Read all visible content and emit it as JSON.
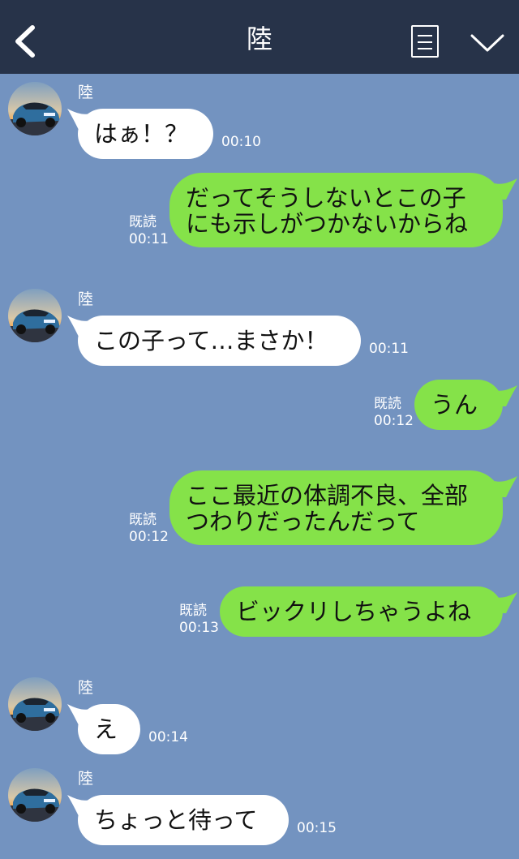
{
  "header": {
    "title": "陸"
  },
  "messages": [
    {
      "side": "in",
      "name": "陸",
      "text": "はぁ！？",
      "time": "00:10"
    },
    {
      "side": "out",
      "read": "既読",
      "lines": [
        "だってそうしないとこの子",
        "にも示しがつかないからね"
      ],
      "time": "00:11"
    },
    {
      "side": "in",
      "name": "陸",
      "text": "この子って…まさか！",
      "time": "00:11"
    },
    {
      "side": "out",
      "read": "既読",
      "text": "うん",
      "time": "00:12"
    },
    {
      "side": "out",
      "read": "既読",
      "lines": [
        "ここ最近の体調不良、全部",
        "つわりだったんだって"
      ],
      "time": "00:12"
    },
    {
      "side": "out",
      "read": "既読",
      "text": "ビックリしちゃうよね",
      "time": "00:13"
    },
    {
      "side": "in",
      "name": "陸",
      "text": "え",
      "time": "00:14"
    },
    {
      "side": "in",
      "name": "陸",
      "text": "ちょっと待って",
      "time": "00:15"
    }
  ],
  "colors": {
    "header": "#273349",
    "background": "#7393c0",
    "outgoing": "#85e249",
    "incoming": "#ffffff"
  },
  "icons": {
    "back": "chevron-left-icon",
    "menu": "notes-icon",
    "expand": "chevron-down-icon",
    "avatar": "car-photo"
  }
}
